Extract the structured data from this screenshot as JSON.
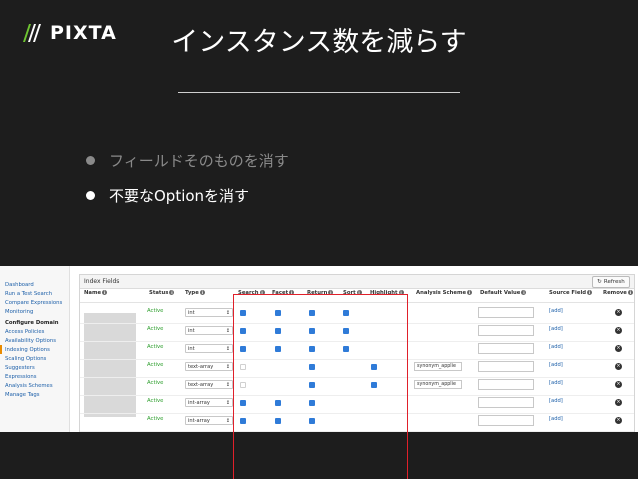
{
  "slide": {
    "logo_text": "PIXTA",
    "title": "インスタンス数を減らす",
    "bullets": [
      "フィールドそのものを消す",
      "不要なOptionを消す"
    ]
  },
  "sidebar": {
    "items": [
      {
        "label": "Dashboard",
        "kind": "link"
      },
      {
        "label": "Run a Test Search",
        "kind": "link"
      },
      {
        "label": "Compare Expressions",
        "kind": "link"
      },
      {
        "label": "Monitoring",
        "kind": "link"
      },
      {
        "label": "Configure Domain",
        "kind": "header"
      },
      {
        "label": "Access Policies",
        "kind": "link"
      },
      {
        "label": "Availability Options",
        "kind": "link"
      },
      {
        "label": "Indexing Options",
        "kind": "selected"
      },
      {
        "label": "Scaling Options",
        "kind": "link"
      },
      {
        "label": "Suggesters",
        "kind": "link"
      },
      {
        "label": "Expressions",
        "kind": "link"
      },
      {
        "label": "Analysis Schemes",
        "kind": "link"
      },
      {
        "label": "Manage Tags",
        "kind": "link"
      }
    ]
  },
  "panel": {
    "title": "Index Fields",
    "refresh_label": "Refresh",
    "columns": [
      "Name",
      "Status",
      "Type",
      "Search",
      "Facet",
      "Return",
      "Sort",
      "Highlight",
      "Analysis Scheme",
      "Default Value",
      "Source Field",
      "Remove"
    ],
    "rows": [
      {
        "status": "Active",
        "type": "int",
        "search": true,
        "facet": true,
        "return": true,
        "sort": true,
        "highlight": false,
        "scheme": "",
        "source": "[add]"
      },
      {
        "status": "Active",
        "type": "int",
        "search": true,
        "facet": true,
        "return": true,
        "sort": true,
        "highlight": false,
        "scheme": "",
        "source": "[add]"
      },
      {
        "status": "Active",
        "type": "int",
        "search": true,
        "facet": true,
        "return": true,
        "sort": true,
        "highlight": false,
        "scheme": "",
        "source": "[add]"
      },
      {
        "status": "Active",
        "type": "text-array",
        "search": "disabled",
        "facet": false,
        "return": true,
        "sort": false,
        "highlight": true,
        "scheme": "synonym_applie",
        "source": "[add]"
      },
      {
        "status": "Active",
        "type": "text-array",
        "search": "disabled",
        "facet": false,
        "return": true,
        "sort": false,
        "highlight": true,
        "scheme": "synonym_applie",
        "source": "[add]"
      },
      {
        "status": "Active",
        "type": "int-array",
        "search": true,
        "facet": true,
        "return": true,
        "sort": false,
        "highlight": false,
        "scheme": "",
        "source": "[add]"
      },
      {
        "status": "Active",
        "type": "int-array",
        "search": true,
        "facet": true,
        "return": true,
        "sort": false,
        "highlight": false,
        "scheme": "",
        "source": "[add]"
      }
    ]
  },
  "colors": {
    "background": "#1d1d1d",
    "highlight_box": "#e0202a",
    "checkbox": "#2f7bd8",
    "active": "#2a9d2a",
    "link": "#1b5ea8"
  }
}
